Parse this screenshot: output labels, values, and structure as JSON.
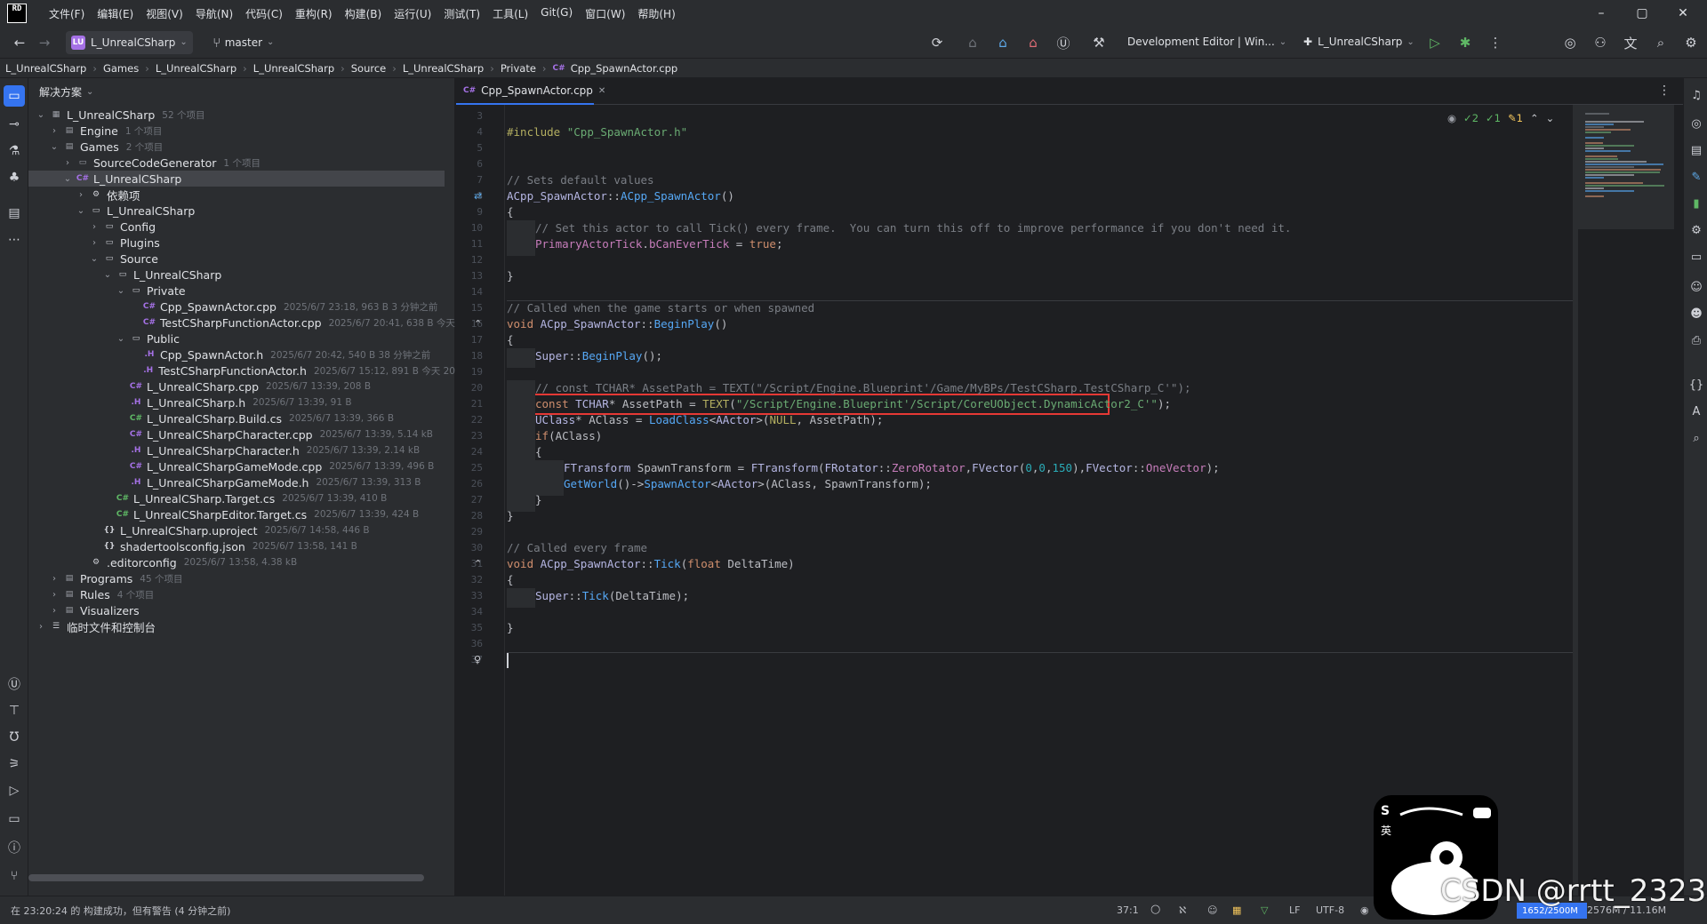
{
  "menubar": {
    "logo": "RD",
    "items": [
      "文件(F)",
      "编辑(E)",
      "视图(V)",
      "导航(N)",
      "代码(C)",
      "重构(R)",
      "构建(B)",
      "运行(U)",
      "测试(T)",
      "工具(L)",
      "Git(G)",
      "窗口(W)",
      "帮助(H)"
    ],
    "minimize": "–",
    "maximize": "▢",
    "close": "✕"
  },
  "toolbar": {
    "project_badge": "LU",
    "project_name": "L_UnrealCSharp",
    "branch": "master",
    "config": "Development Editor | Win...",
    "run_target": "L_UnrealCSharp"
  },
  "breadcrumb": [
    "L_UnrealCSharp",
    "Games",
    "L_UnrealCSharp",
    "L_UnrealCSharp",
    "Source",
    "L_UnrealCSharp",
    "Private",
    "Cpp_SpawnActor.cpp"
  ],
  "explorer": {
    "title": "解决方案",
    "rows": [
      {
        "label": "L_UnrealCSharp",
        "meta": "52 个项目",
        "depth": 0,
        "arrow": "⌄",
        "icon": "▦",
        "icon_color": "#9da0a8"
      },
      {
        "label": "Engine",
        "meta": "1 个项目",
        "depth": 1,
        "arrow": "›",
        "icon": "▤",
        "icon_color": "#9da0a8"
      },
      {
        "label": "Games",
        "meta": "2 个项目",
        "depth": 1,
        "arrow": "⌄",
        "icon": "▤",
        "icon_color": "#9da0a8"
      },
      {
        "label": "SourceCodeGenerator",
        "meta": "1 个项目",
        "depth": 2,
        "arrow": "›",
        "icon": "▭",
        "icon_color": "#9da0a8"
      },
      {
        "label": "L_UnrealCSharp",
        "meta": "",
        "depth": 2,
        "arrow": "⌄",
        "icon": "C#",
        "icon_color": "#a571e6",
        "selected": true
      },
      {
        "label": "依赖项",
        "meta": "",
        "depth": 3,
        "arrow": "›",
        "icon": "⚙",
        "icon_color": "#ced0d6"
      },
      {
        "label": "L_UnrealCSharp",
        "meta": "",
        "depth": 3,
        "arrow": "⌄",
        "icon": "▭",
        "icon_color": "#ced0d6"
      },
      {
        "label": "Config",
        "meta": "",
        "depth": 4,
        "arrow": "›",
        "icon": "▭",
        "icon_color": "#ced0d6"
      },
      {
        "label": "Plugins",
        "meta": "",
        "depth": 4,
        "arrow": "›",
        "icon": "▭",
        "icon_color": "#ced0d6"
      },
      {
        "label": "Source",
        "meta": "",
        "depth": 4,
        "arrow": "⌄",
        "icon": "▭",
        "icon_color": "#ced0d6"
      },
      {
        "label": "L_UnrealCSharp",
        "meta": "",
        "depth": 5,
        "arrow": "⌄",
        "icon": "▭",
        "icon_color": "#ced0d6"
      },
      {
        "label": "Private",
        "meta": "",
        "depth": 6,
        "arrow": "⌄",
        "icon": "▭",
        "icon_color": "#ced0d6"
      },
      {
        "label": "Cpp_SpawnActor.cpp",
        "meta": "2025/6/7 23:18, 963 B 3 分钟之前",
        "depth": 7,
        "arrow": "",
        "icon": "C#",
        "icon_color": "#a571e6"
      },
      {
        "label": "TestCSharpFunctionActor.cpp",
        "meta": "2025/6/7 20:41, 638 B 今天",
        "depth": 7,
        "arrow": "",
        "icon": "C#",
        "icon_color": "#a571e6"
      },
      {
        "label": "Public",
        "meta": "",
        "depth": 6,
        "arrow": "⌄",
        "icon": "▭",
        "icon_color": "#ced0d6"
      },
      {
        "label": "Cpp_SpawnActor.h",
        "meta": "2025/6/7 20:42, 540 B 38 分钟之前",
        "depth": 7,
        "arrow": "",
        "icon": ".H",
        "icon_color": "#a571e6"
      },
      {
        "label": "TestCSharpFunctionActor.h",
        "meta": "2025/6/7 15:12, 891 B 今天 20",
        "depth": 7,
        "arrow": "",
        "icon": ".H",
        "icon_color": "#a571e6"
      },
      {
        "label": "L_UnrealCSharp.cpp",
        "meta": "2025/6/7 13:39, 208 B",
        "depth": 6,
        "arrow": "",
        "icon": "C#",
        "icon_color": "#a571e6"
      },
      {
        "label": "L_UnrealCSharp.h",
        "meta": "2025/6/7 13:39, 91 B",
        "depth": 6,
        "arrow": "",
        "icon": ".H",
        "icon_color": "#a571e6"
      },
      {
        "label": "L_UnrealCSharp.Build.cs",
        "meta": "2025/6/7 13:39, 366 B",
        "depth": 6,
        "arrow": "",
        "icon": "C#",
        "icon_color": "#5fb865"
      },
      {
        "label": "L_UnrealCSharpCharacter.cpp",
        "meta": "2025/6/7 13:39, 5.14 kB",
        "depth": 6,
        "arrow": "",
        "icon": "C#",
        "icon_color": "#a571e6"
      },
      {
        "label": "L_UnrealCSharpCharacter.h",
        "meta": "2025/6/7 13:39, 2.14 kB",
        "depth": 6,
        "arrow": "",
        "icon": ".H",
        "icon_color": "#a571e6"
      },
      {
        "label": "L_UnrealCSharpGameMode.cpp",
        "meta": "2025/6/7 13:39, 496 B",
        "depth": 6,
        "arrow": "",
        "icon": "C#",
        "icon_color": "#a571e6"
      },
      {
        "label": "L_UnrealCSharpGameMode.h",
        "meta": "2025/6/7 13:39, 313 B",
        "depth": 6,
        "arrow": "",
        "icon": ".H",
        "icon_color": "#a571e6"
      },
      {
        "label": "L_UnrealCSharp.Target.cs",
        "meta": "2025/6/7 13:39, 410 B",
        "depth": 5,
        "arrow": "",
        "icon": "C#",
        "icon_color": "#5fb865"
      },
      {
        "label": "L_UnrealCSharpEditor.Target.cs",
        "meta": "2025/6/7 13:39, 424 B",
        "depth": 5,
        "arrow": "",
        "icon": "C#",
        "icon_color": "#5fb865"
      },
      {
        "label": "L_UnrealCSharp.uproject",
        "meta": "2025/6/7 14:58, 446 B",
        "depth": 4,
        "arrow": "",
        "icon": "{}",
        "icon_color": "#ced0d6"
      },
      {
        "label": "shadertoolsconfig.json",
        "meta": "2025/6/7 13:58, 141 B",
        "depth": 4,
        "arrow": "",
        "icon": "{}",
        "icon_color": "#ced0d6"
      },
      {
        "label": ".editorconfig",
        "meta": "2025/6/7 13:58, 4.38 kB",
        "depth": 3,
        "arrow": "",
        "icon": "⚙",
        "icon_color": "#ced0d6"
      },
      {
        "label": "Programs",
        "meta": "45 个项目",
        "depth": 1,
        "arrow": "›",
        "icon": "▤",
        "icon_color": "#9da0a8"
      },
      {
        "label": "Rules",
        "meta": "4 个项目",
        "depth": 1,
        "arrow": "›",
        "icon": "▤",
        "icon_color": "#9da0a8"
      },
      {
        "label": "Visualizers",
        "meta": "",
        "depth": 1,
        "arrow": "›",
        "icon": "▤",
        "icon_color": "#9da0a8"
      },
      {
        "label": "临时文件和控制台",
        "meta": "",
        "depth": 0,
        "arrow": "›",
        "icon": "☰",
        "icon_color": "#ced0d6"
      }
    ]
  },
  "editor": {
    "tab_label": "Cpp_SpawnActor.cpp",
    "tab_close": "✕",
    "inspections": {
      "ok_a": "2",
      "ok_b": "1",
      "warn": "1"
    },
    "lines": [
      {
        "n": "3",
        "html": ""
      },
      {
        "n": "4",
        "html": "<span class='mac'>#include</span> <span class='str'>\"Cpp_SpawnActor.h\"</span>"
      },
      {
        "n": "5",
        "html": ""
      },
      {
        "n": "6",
        "html": ""
      },
      {
        "n": "7",
        "html": "<span class='cm'>// Sets default values</span>"
      },
      {
        "n": "8",
        "html": "<span class='ty'>ACpp_SpawnActor</span>::<span class='fn'>ACpp_SpawnActor</span>()"
      },
      {
        "n": "9",
        "html": "{"
      },
      {
        "n": "10",
        "html": "<span class='indent-guide'></span><span class='cm'>// Set this actor to call Tick() every frame.  You can turn this off to improve performance if you don't need it.</span>"
      },
      {
        "n": "11",
        "html": "<span class='indent-guide'></span><span class='field'>PrimaryActorTick</span>.<span class='field'>bCanEverTick</span> = <span class='kw'>true</span>;"
      },
      {
        "n": "12",
        "html": ""
      },
      {
        "n": "13",
        "html": "}"
      },
      {
        "n": "14",
        "html": ""
      },
      {
        "n": "15",
        "html": "<span class='cm'>// Called when the game starts or when spawned</span>"
      },
      {
        "n": "16",
        "html": "<span class='kw'>void</span> <span class='ty'>ACpp_SpawnActor</span>::<span class='fn'>BeginPlay</span>()"
      },
      {
        "n": "17",
        "html": "{"
      },
      {
        "n": "18",
        "html": "<span class='indent-guide'></span><span class='ty'>Super</span>::<span class='fn'>BeginPlay</span>();"
      },
      {
        "n": "19",
        "html": ""
      },
      {
        "n": "20",
        "html": "<span class='indent-guide'></span><span class='cm'>// const TCHAR* AssetPath = TEXT(\"/Script/Engine.Blueprint'/Game/MyBPs/TestCSharp.TestCSharp_C'\");</span>"
      },
      {
        "n": "21",
        "html": "<span class='indent-guide'></span><span class='kw'>const</span> <span class='ty'>TCHAR</span>* AssetPath = <span class='mac'>TEXT</span>(<span class='str'>\"/Script/Engine.Blueprint'/Script/CoreUObject.DynamicActor2_C'\"</span>);"
      },
      {
        "n": "22",
        "html": "<span class='indent-guide'></span><span class='ty'>UClass</span>* AClass = <span class='fn'>LoadClass</span>&lt;<span class='ty'>AActor</span>&gt;(<span class='mac'>NULL</span>, AssetPath);"
      },
      {
        "n": "23",
        "html": "<span class='indent-guide'></span><span class='kw'>if</span>(AClass)"
      },
      {
        "n": "24",
        "html": "<span class='indent-guide'></span>{"
      },
      {
        "n": "25",
        "html": "<span class='indent-guide'></span><span class='indent-guide'></span><span class='ty'>FTransform</span> SpawnTransform = <span class='ty'>FTransform</span>(<span class='ty'>FRotator</span>::<span class='field'>ZeroRotator</span>,<span class='ty'>FVector</span>(<span class='num'>0</span>,<span class='num'>0</span>,<span class='num'>150</span>),<span class='ty'>FVector</span>::<span class='field'>OneVector</span>);"
      },
      {
        "n": "26",
        "html": "<span class='indent-guide'></span><span class='indent-guide'></span><span class='fn'>GetWorld</span>()-&gt;<span class='fn'>SpawnActor</span>&lt;<span class='ty'>AActor</span>&gt;(AClass, SpawnTransform);"
      },
      {
        "n": "27",
        "html": "<span class='indent-guide'></span>}"
      },
      {
        "n": "28",
        "html": "}"
      },
      {
        "n": "29",
        "html": ""
      },
      {
        "n": "30",
        "html": "<span class='cm'>// Called every frame</span>"
      },
      {
        "n": "31",
        "html": "<span class='kw'>void</span> <span class='ty'>ACpp_SpawnActor</span>::<span class='fn'>Tick</span>(<span class='kw'>float</span> DeltaTime)"
      },
      {
        "n": "32",
        "html": "{"
      },
      {
        "n": "33",
        "html": "<span class='indent-guide'></span><span class='ty'>Super</span>::<span class='fn'>Tick</span>(DeltaTime);"
      },
      {
        "n": "34",
        "html": ""
      },
      {
        "n": "35",
        "html": "}"
      },
      {
        "n": "36",
        "html": ""
      },
      {
        "n": "37",
        "html": ""
      }
    ]
  },
  "statusbar": {
    "message": "在 23:20:24 的 构建成功，但有警告 (4 分钟之前)",
    "position": "37:1",
    "line_ending": "LF",
    "encoding": "UTF-8",
    "memory": "1652/2500M",
    "memory_fraction": 0.66,
    "memory_extra": "2576M / 11.16M"
  },
  "watermark": {
    "text": "CSDN @rrtt_2323"
  },
  "colors": {
    "accent": "#3574f0",
    "highlight_box": "#e53935",
    "project_badge": "#a571e6"
  }
}
